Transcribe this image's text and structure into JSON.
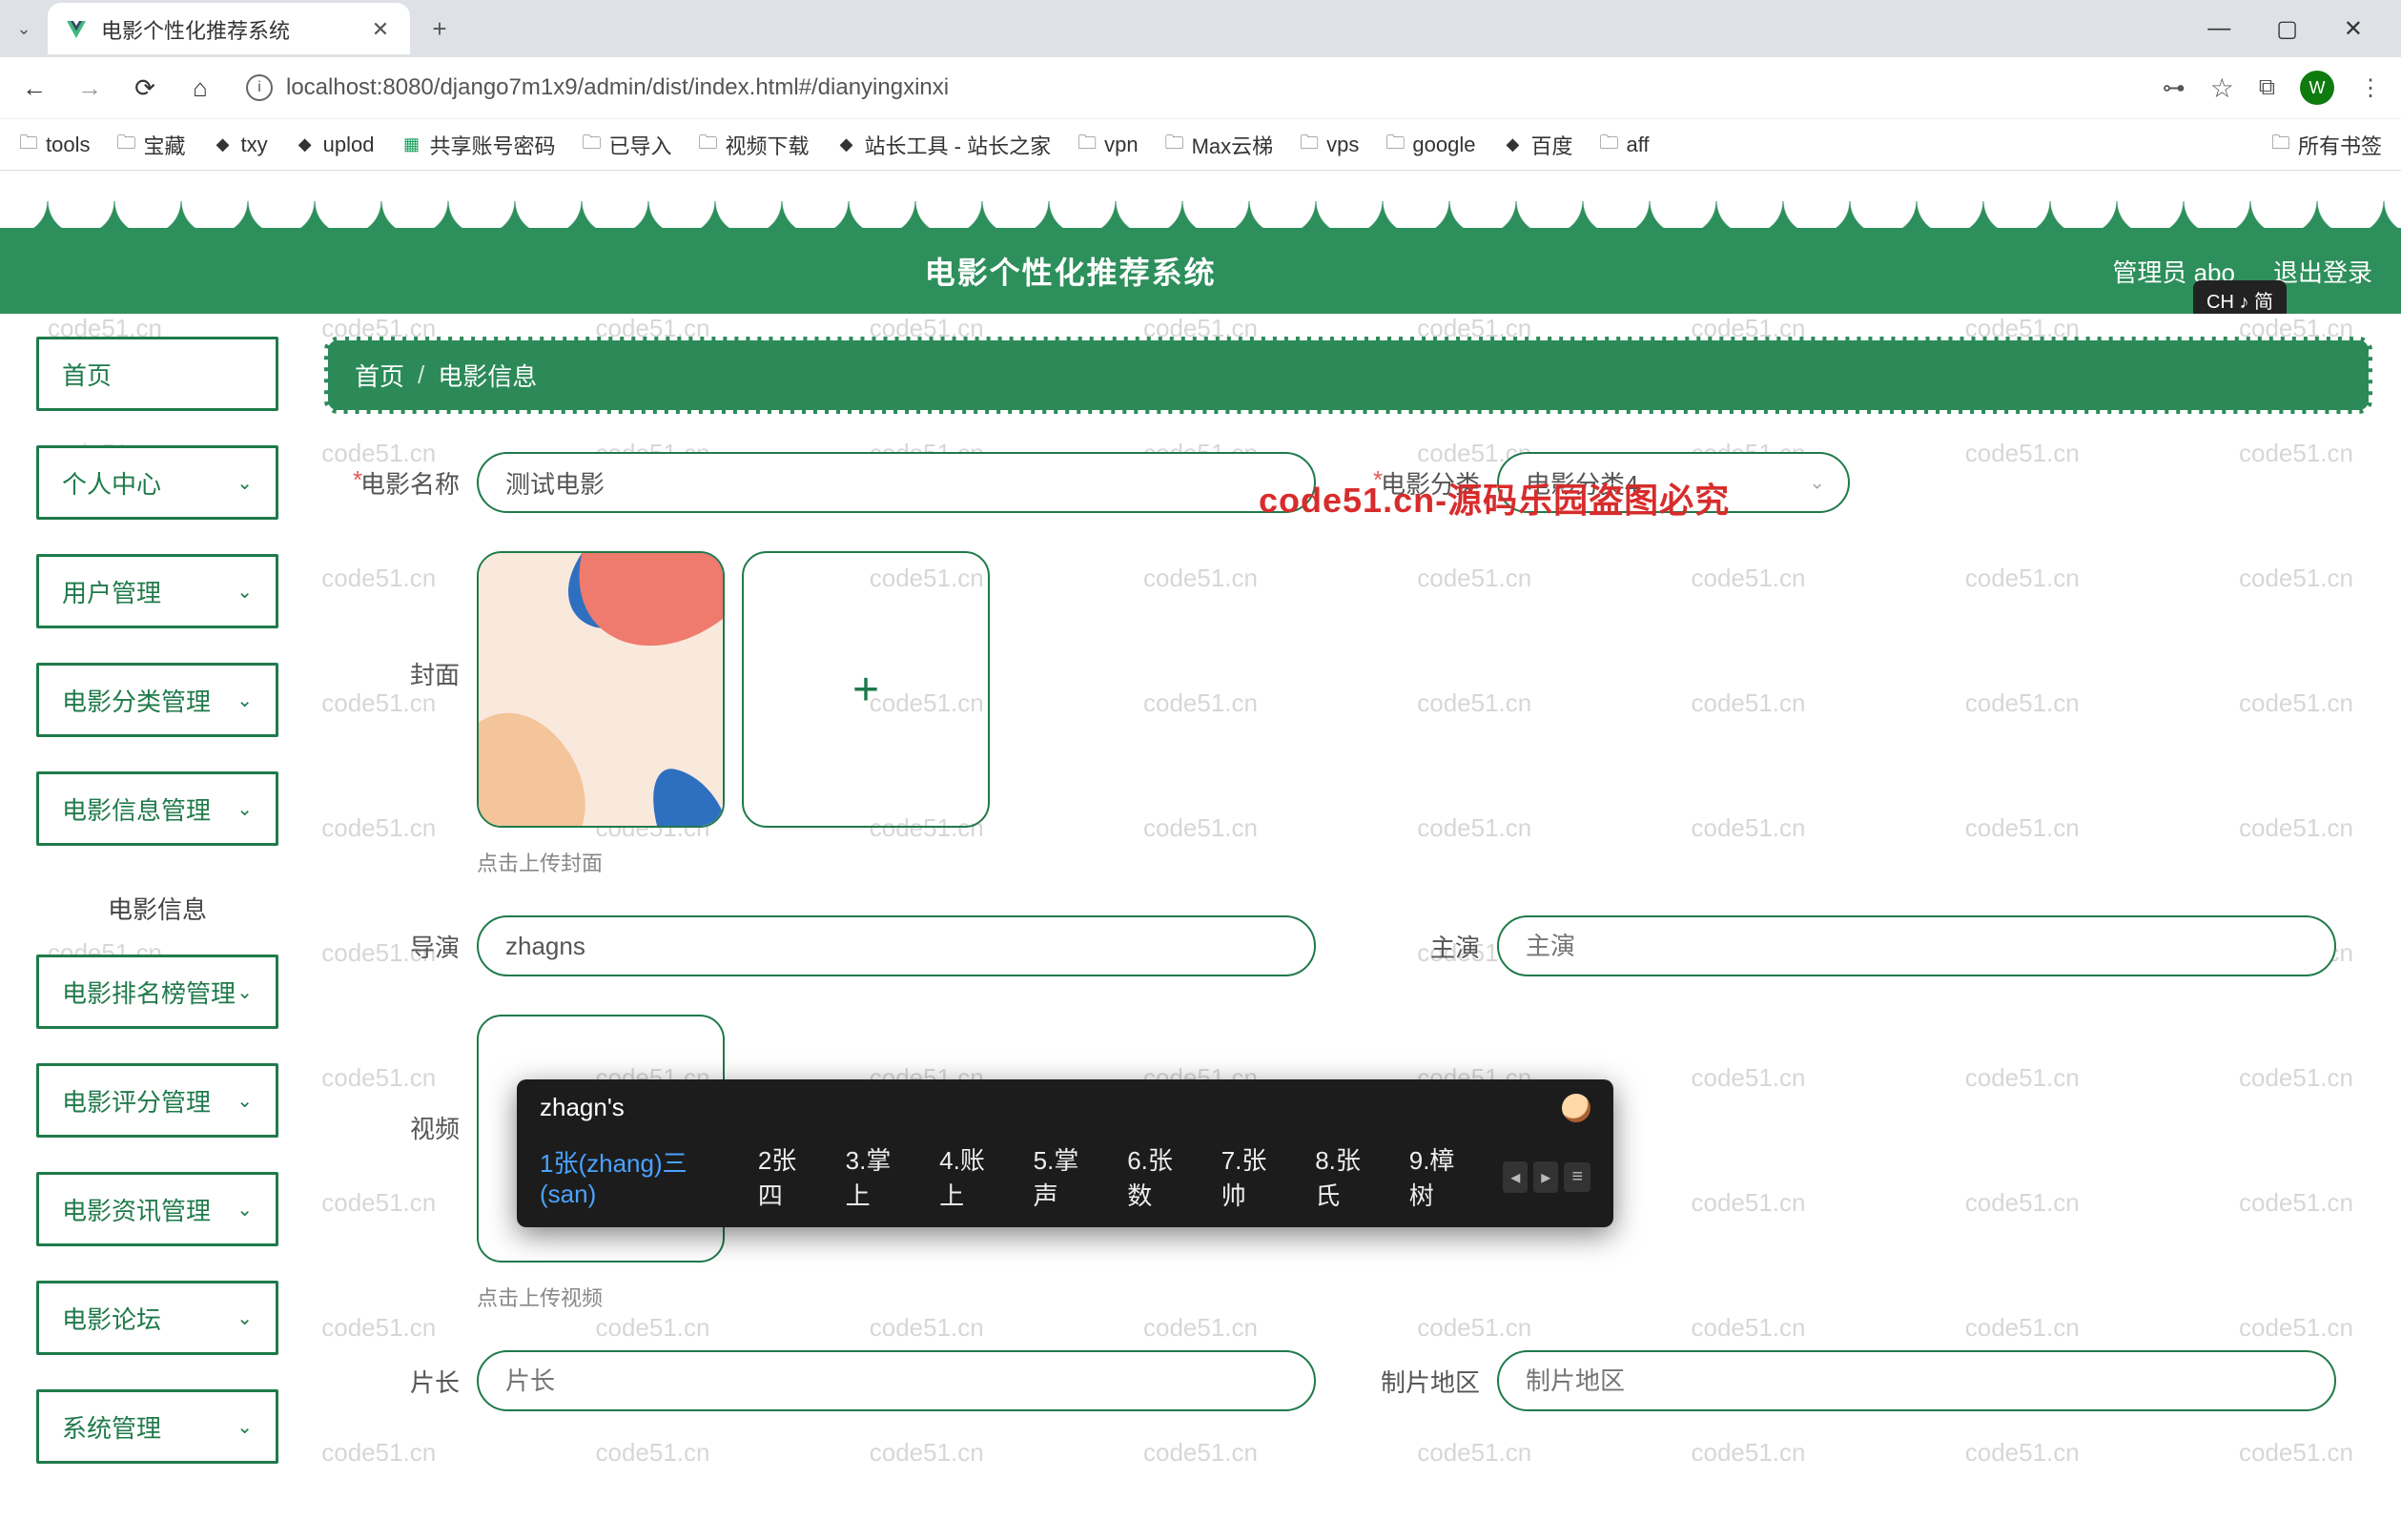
{
  "browser": {
    "tab_title": "电影个性化推荐系统",
    "url": "localhost:8080/django7m1x9/admin/dist/index.html#/dianyingxinxi",
    "profile_initial": "W",
    "bookmarks": [
      "tools",
      "宝藏",
      "txy",
      "uplod",
      "共享账号密码",
      "已导入",
      "视频下载",
      "站长工具 - 站长之家",
      "vpn",
      "Max云梯",
      "vps",
      "google",
      "百度",
      "aff"
    ],
    "all_bookmarks": "所有书签"
  },
  "header": {
    "title": "电影个性化推荐系统",
    "user_label": "管理员 abo",
    "logout": "退出登录",
    "ime_badge": "CH ♪ 简"
  },
  "sidebar": {
    "items": [
      {
        "label": "首页",
        "expandable": false
      },
      {
        "label": "个人中心",
        "expandable": true
      },
      {
        "label": "用户管理",
        "expandable": true
      },
      {
        "label": "电影分类管理",
        "expandable": true
      },
      {
        "label": "电影信息管理",
        "expandable": true
      },
      {
        "label": "电影信息",
        "expandable": false,
        "sub": true
      },
      {
        "label": "电影排名榜管理",
        "expandable": true
      },
      {
        "label": "电影评分管理",
        "expandable": true
      },
      {
        "label": "电影资讯管理",
        "expandable": true
      },
      {
        "label": "电影论坛",
        "expandable": true
      },
      {
        "label": "系统管理",
        "expandable": true
      }
    ]
  },
  "breadcrumb": {
    "home": "首页",
    "current": "电影信息"
  },
  "form": {
    "movie_name_label": "电影名称",
    "movie_name_value": "测试电影",
    "category_label": "电影分类",
    "category_value": "电影分类4",
    "cover_label": "封面",
    "cover_hint": "点击上传封面",
    "director_label": "导演",
    "director_value": "zhagns",
    "starring_label": "主演",
    "starring_placeholder": "主演",
    "video_label": "视频",
    "video_hint": "点击上传视频",
    "length_label": "片长",
    "length_placeholder": "片长",
    "region_label": "制片地区",
    "region_placeholder": "制片地区"
  },
  "ime": {
    "composition": "zhagn's",
    "candidates": [
      "1张(zhang)三(san)",
      "2张四",
      "3.掌上",
      "4.账上",
      "5.掌声",
      "6.张数",
      "7.张帅",
      "8.张氏",
      "9.樟树"
    ]
  },
  "watermark": {
    "text": "code51.cn",
    "red_text": "code51.cn-源码乐园盗图必究"
  }
}
